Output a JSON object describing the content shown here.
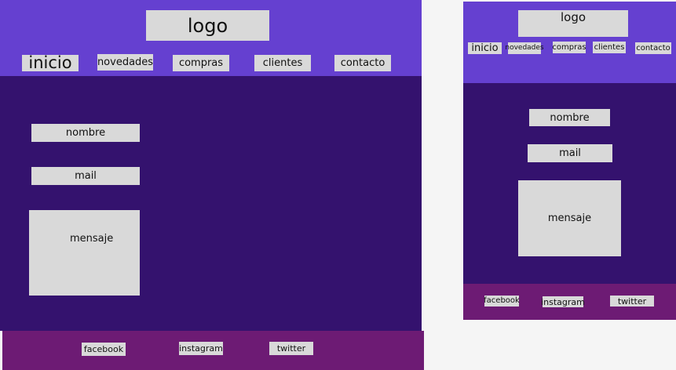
{
  "desktop": {
    "logo": "logo",
    "nav": [
      "inicio",
      "novedades",
      "compras",
      "clientes",
      "contacto"
    ],
    "form": {
      "name": "nombre",
      "mail": "mail",
      "message": "mensaje"
    },
    "social": [
      "facebook",
      "instagram",
      "twitter"
    ]
  },
  "mobile": {
    "logo": "logo",
    "nav": [
      "inicio",
      "novedades",
      "compras",
      "clientes",
      "contacto"
    ],
    "form": {
      "name": "nombre",
      "mail": "mail",
      "message": "mensaje"
    },
    "social": [
      "facebook",
      "instagram",
      "twitter"
    ]
  },
  "colors": {
    "header": "#6540d0",
    "main": "#34126e",
    "footer": "#6d1b74",
    "placeholder": "#d9d9d9",
    "canvas": "#f5f5f5"
  }
}
